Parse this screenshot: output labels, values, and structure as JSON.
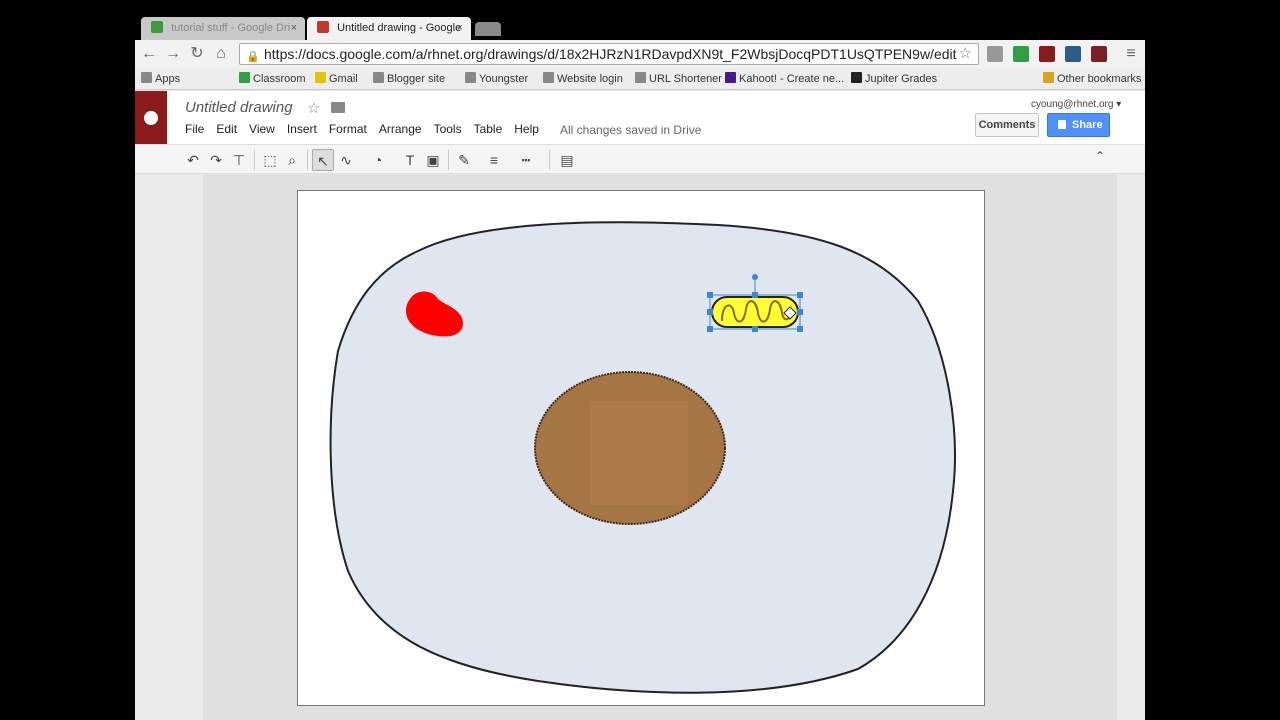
{
  "browser": {
    "tabs": [
      {
        "title": "tutorial stuff - Google Dri",
        "active": false
      },
      {
        "title": "Untitled drawing - Google",
        "active": true
      }
    ],
    "url": "https://docs.google.com/a/rhnet.org/drawings/d/18x2HJRzN1RDavpdXN9t_F2WbsjDocqPDT1UsQTPEN9w/edit",
    "bookmarks": [
      "Apps",
      "Classroom",
      "Gmail",
      "Blogger site",
      "Youngster",
      "Website login",
      "URL Shortener",
      "Kahoot! - Create ne...",
      "Jupiter Grades",
      "Other bookmarks"
    ]
  },
  "app": {
    "doc_title": "Untitled drawing",
    "menu": [
      "File",
      "Edit",
      "View",
      "Insert",
      "Format",
      "Arrange",
      "Tools",
      "Table",
      "Help"
    ],
    "save_status": "All changes saved in Drive",
    "account": "cyoung@rhnet.org",
    "comments_label": "Comments",
    "share_label": "Share"
  },
  "toolbar_icons": [
    "undo-icon",
    "redo-icon",
    "paint-format-icon",
    "zoom-fit-icon",
    "zoom-icon",
    "select-icon",
    "line-icon",
    "shape-icon",
    "textbox-icon",
    "image-icon",
    "line-color-icon",
    "line-weight-icon",
    "line-dash-icon",
    "comment-icon"
  ],
  "colors": {
    "cell_fill": "#dfe6f0",
    "nucleus": "#a57544",
    "red_organelle": "#ff0000",
    "mitochondrion": "#ffff33",
    "selection": "#3d86d6",
    "share_blue": "#4d90fe"
  }
}
